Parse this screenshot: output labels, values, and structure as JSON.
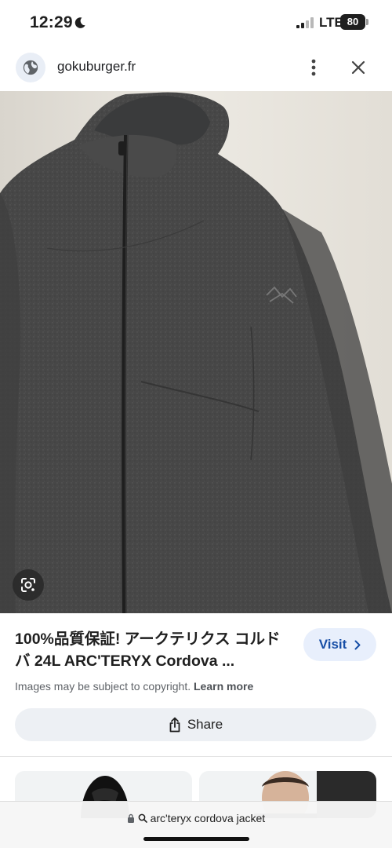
{
  "status_bar": {
    "time": "12:29",
    "network": "LTE",
    "battery": "80"
  },
  "site": {
    "domain": "gokuburger.fr"
  },
  "result": {
    "title": "100%品質保証! アークテリクス コルドバ 24L ARC'TERYX Cordova ...",
    "visit_label": "Visit",
    "copyright_text": "Images may be subject to copyright.",
    "learn_more": "Learn more",
    "share_label": "Share"
  },
  "url_bar": {
    "query": "arc'teryx cordova jacket"
  },
  "colors": {
    "visit_bg": "#e8effc",
    "visit_text": "#174ea6",
    "share_bg": "#edf0f4"
  },
  "icons": [
    "moon-icon",
    "signal-icon",
    "globe-icon",
    "more-vert-icon",
    "close-icon",
    "lens-icon",
    "chevron-right-icon",
    "share-icon",
    "lock-icon",
    "search-icon"
  ]
}
